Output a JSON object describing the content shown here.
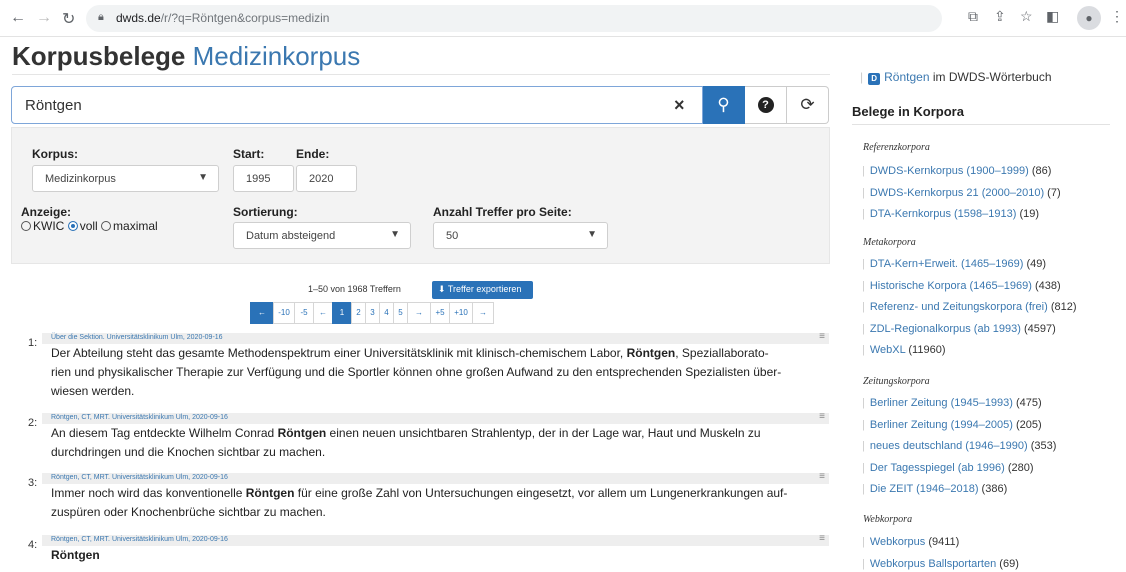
{
  "browser": {
    "url_host": "dwds.de",
    "url_path": "/r/?q=Röntgen&corpus=medizin"
  },
  "page": {
    "title": "Korpusbelege",
    "subtitle": "Medizinkorpus"
  },
  "search": {
    "value": "Röntgen",
    "clear": "×"
  },
  "form": {
    "korpus_label": "Korpus:",
    "korpus_value": "Medizinkorpus",
    "start_label": "Start:",
    "start_value": "1995",
    "ende_label": "Ende:",
    "ende_value": "2020",
    "anzeige_label": "Anzeige:",
    "anzeige_options": [
      "KWIC",
      "voll",
      "maximal"
    ],
    "anzeige_selected": "voll",
    "sort_label": "Sortierung:",
    "sort_value": "Datum absteigend",
    "count_label": "Anzahl Treffer pro Seite:",
    "count_value": "50"
  },
  "results": {
    "summary": "1–50 von 1968 Treffern",
    "export_label": "Treffer exportieren",
    "pager": [
      "←",
      "-10",
      "-5",
      "←",
      "1",
      "2",
      "3",
      "4",
      "5",
      "→",
      "+5",
      "+10",
      "→"
    ],
    "hits": [
      {
        "num": "1:",
        "meta": "Über die Sektion. Universitätsklinikum Ulm, 2020-09-16",
        "lines": [
          [
            "Der Abteilung steht das gesamte Methodenspektrum einer Universitätsklinik mit klinisch-chemischem Labor, ",
            "Röntgen",
            ", Speziallaborato-"
          ],
          [
            "rien und physikalischer Therapie zur Verfügung und die Sportler können ohne großen Aufwand zu den entsprechenden Spezialisten über-",
            "",
            ""
          ],
          [
            "wiesen werden.",
            "",
            ""
          ]
        ]
      },
      {
        "num": "2:",
        "meta": "Röntgen, CT, MRT. Universitätsklinikum Ulm, 2020-09-16",
        "lines": [
          [
            "An diesem Tag entdeckte Wilhelm Conrad ",
            "Röntgen",
            " einen neuen unsichtbaren Strahlentyp, der in der Lage war, Haut und Muskeln zu"
          ],
          [
            "durchdringen und die Knochen sichtbar zu machen.",
            "",
            ""
          ]
        ]
      },
      {
        "num": "3:",
        "meta": "Röntgen, CT, MRT. Universitätsklinikum Ulm, 2020-09-16",
        "lines": [
          [
            "Immer noch wird das konventionelle ",
            "Röntgen",
            " für eine große Zahl von Untersuchungen eingesetzt, vor allem um Lungenerkrankungen auf-"
          ],
          [
            "zuspüren oder Knochenbrüche sichtbar zu machen.",
            "",
            ""
          ]
        ]
      },
      {
        "num": "4:",
        "meta": "Röntgen, CT, MRT. Universitätsklinikum Ulm, 2020-09-16",
        "lines": [
          [
            "",
            "Röntgen",
            ""
          ]
        ]
      }
    ]
  },
  "sidebar": {
    "dict_badge": "D",
    "dict_link": "Röntgen",
    "dict_suffix": "im DWDS-Wörterbuch",
    "heading": "Belege in Korpora",
    "groups": [
      {
        "name": "Referenzkorpora",
        "items": [
          {
            "label": "DWDS-Kernkorpus (1900–1999)",
            "count": "(86)"
          },
          {
            "label": "DWDS-Kernkorpus 21 (2000–2010)",
            "count": "(7)"
          },
          {
            "label": "DTA-Kernkorpus (1598–1913)",
            "count": "(19)"
          }
        ]
      },
      {
        "name": "Metakorpora",
        "items": [
          {
            "label": "DTA-Kern+Erweit. (1465–1969)",
            "count": "(49)"
          },
          {
            "label": "Historische Korpora (1465–1969)",
            "count": "(438)"
          },
          {
            "label": "Referenz- und Zeitungskorpora (frei)",
            "count": "(812)"
          },
          {
            "label": "ZDL-Regionalkorpus (ab 1993)",
            "count": "(4597)"
          },
          {
            "label": "WebXL",
            "count": "(11960)"
          }
        ]
      },
      {
        "name": "Zeitungskorpora",
        "items": [
          {
            "label": "Berliner Zeitung (1945–1993)",
            "count": "(475)"
          },
          {
            "label": "Berliner Zeitung (1994–2005)",
            "count": "(205)"
          },
          {
            "label": "neues deutschland (1946–1990)",
            "count": "(353)"
          },
          {
            "label": "Der Tagesspiegel (ab 1996)",
            "count": "(280)"
          },
          {
            "label": "Die ZEIT (1946–2018)",
            "count": "(386)"
          }
        ]
      },
      {
        "name": "Webkorpora",
        "items": [
          {
            "label": "Webkorpus",
            "count": "(9411)"
          },
          {
            "label": "Webkorpus Ballsportarten",
            "count": "(69)"
          }
        ]
      }
    ]
  },
  "colors": {
    "accent": "#2a72b8",
    "link": "#3b78b0"
  }
}
